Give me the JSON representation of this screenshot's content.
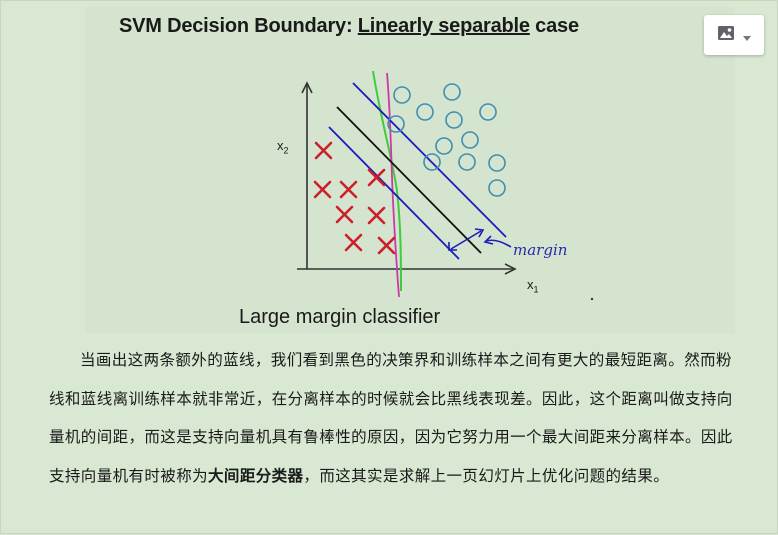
{
  "slide": {
    "title_prefix": "SVM Decision Boundary: ",
    "title_underlined": "Linearly separable",
    "title_suffix": " case",
    "x1_label": "x",
    "x1_sub": "1",
    "x2_label": "x",
    "x2_sub": "2",
    "margin_label": "margin",
    "caption": "Large margin classifier",
    "colors": {
      "cross": "#cc1f2a",
      "circle": "#3f8fb0",
      "boundary_black": "#111111",
      "margin_blue": "#1d1dbb",
      "green_line": "#3dcc3d",
      "pink_line": "#cc3aa8",
      "axis": "#333333"
    }
  },
  "toolbar": {
    "image_icon": "image-icon",
    "dropdown_icon": "caret-down-icon"
  },
  "paragraph": {
    "part1": "当画出这两条额外的蓝线，我们看到黑色的决策界和训练样本之间有更大的最短距离。然而粉线和蓝线离训练样本就非常近，在分离样本的时候就会比黑线表现差。因此，这个距离叫做支持向量机的间距，而这是支持向量机具有鲁棒性的原因，因为它努力用一个最大间距来分离样本。因此支持向量机有时被称为",
    "bold": "大间距分类器",
    "part2": "，而这其实是求解上一页幻灯片上优化问题的结果。"
  }
}
